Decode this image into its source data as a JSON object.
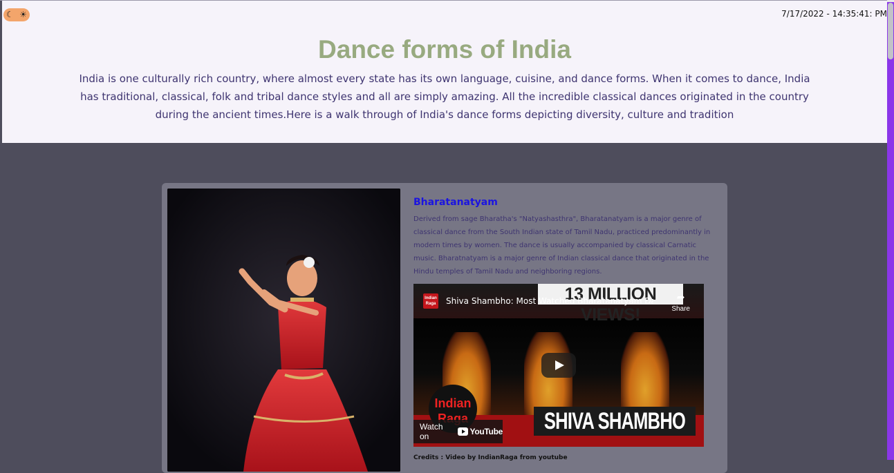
{
  "header": {
    "theme_toggle": {
      "moon": "☾",
      "sun": "☀"
    },
    "datetime": "7/17/2022 - 14:35:41: PM",
    "title": "Dance forms of India",
    "intro": "India is one culturally rich country, where almost every state has its own language, cuisine, and dance forms. When it comes to dance, India has traditional, classical, folk and tribal dance styles and all are simply amazing. All the incredible classical dances originated in the country during the ancient times.Here is a walk through of India's dance forms depicting diversity, culture and tradition"
  },
  "card": {
    "title": "Bharatanatyam",
    "description": "Derived from sage Bharatha's \"Natyashasthra\", Bharatanatyam is a major genre of classical dance from the South Indian state of Tamil Nadu, practiced predominantly in modern times by women. The dance is usually accompanied by classical Carnatic music. Bharatnatyam is a major genre of Indian classical dance that originated in the Hindu temples of Tamil Nadu and neighboring regions.",
    "video": {
      "logo_text": "Indian\nRaga",
      "title": "Shiva Shambho: Most Watched Bharatanatyam Da...",
      "views_banner": "13 MILLION VIEWS!",
      "share_label": "Share",
      "brand_text": "Indian\nRaga",
      "overlay_title": "SHIVA SHAMBHO",
      "watch_on_label": "Watch on",
      "youtube_label": "YouTube"
    },
    "credits": "Credits : Video by IndianRaga from youtube"
  },
  "colors": {
    "page_bg": "#4e4d5c",
    "header_bg": "#f6f3fa",
    "title": "#98aa80",
    "intro_text": "#3e3470",
    "card_bg": "#777685",
    "card_title": "#1b14e0",
    "scrollbar": "#8b36e9",
    "theme_toggle": "#f3a56b"
  }
}
